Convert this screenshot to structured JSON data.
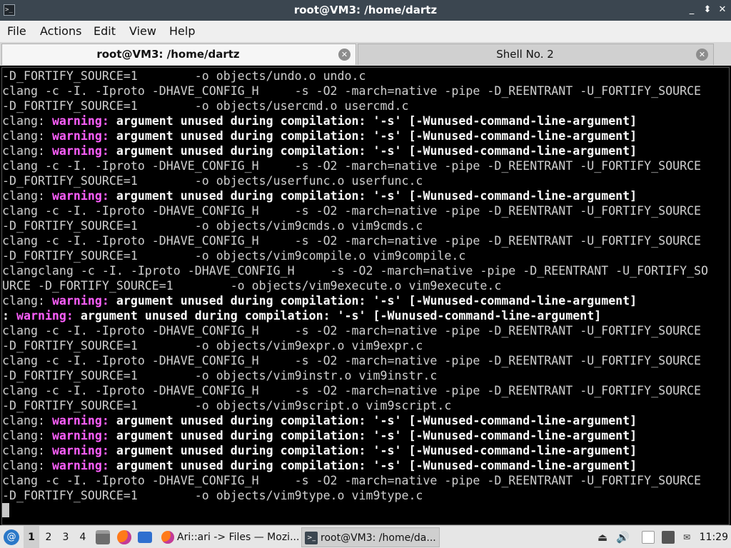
{
  "window": {
    "title": "root@VM3: /home/dartz",
    "controls": {
      "minimize": "_",
      "maximize": "⬍",
      "close": "✕"
    }
  },
  "menu": [
    "File",
    "Actions",
    "Edit",
    "View",
    "Help"
  ],
  "tabs": [
    {
      "label": "root@VM3: /home/dartz",
      "close": "✕"
    },
    {
      "label": "Shell No. 2",
      "close": "✕"
    }
  ],
  "terminal": {
    "lines": [
      [
        {
          "t": "-D_FORTIFY_SOURCE=1        -o objects/undo.o undo.c"
        }
      ],
      [
        {
          "t": "clang -c -I. -Iproto -DHAVE_CONFIG_H     -s -O2 -march=native -pipe -D_REENTRANT -U_FORTIFY_SOURCE"
        }
      ],
      [
        {
          "t": "-D_FORTIFY_SOURCE=1        -o objects/usercmd.o usercmd.c"
        }
      ],
      [
        {
          "t": "clang: "
        },
        {
          "t": "warning:",
          "c": "w"
        },
        {
          "t": " argument unused during compilation: '-s' [-Wunused-command-line-argument]",
          "c": "b"
        }
      ],
      [
        {
          "t": "clang: "
        },
        {
          "t": "warning:",
          "c": "w"
        },
        {
          "t": " argument unused during compilation: '-s' [-Wunused-command-line-argument]",
          "c": "b"
        }
      ],
      [
        {
          "t": "clang: "
        },
        {
          "t": "warning:",
          "c": "w"
        },
        {
          "t": " argument unused during compilation: '-s' [-Wunused-command-line-argument]",
          "c": "b"
        }
      ],
      [
        {
          "t": "clang -c -I. -Iproto -DHAVE_CONFIG_H     -s -O2 -march=native -pipe -D_REENTRANT -U_FORTIFY_SOURCE"
        }
      ],
      [
        {
          "t": "-D_FORTIFY_SOURCE=1        -o objects/userfunc.o userfunc.c"
        }
      ],
      [
        {
          "t": "clang: "
        },
        {
          "t": "warning:",
          "c": "w"
        },
        {
          "t": " argument unused during compilation: '-s' [-Wunused-command-line-argument]",
          "c": "b"
        }
      ],
      [
        {
          "t": "clang -c -I. -Iproto -DHAVE_CONFIG_H     -s -O2 -march=native -pipe -D_REENTRANT -U_FORTIFY_SOURCE"
        }
      ],
      [
        {
          "t": "-D_FORTIFY_SOURCE=1        -o objects/vim9cmds.o vim9cmds.c"
        }
      ],
      [
        {
          "t": "clang -c -I. -Iproto -DHAVE_CONFIG_H     -s -O2 -march=native -pipe -D_REENTRANT -U_FORTIFY_SOURCE"
        }
      ],
      [
        {
          "t": "-D_FORTIFY_SOURCE=1        -o objects/vim9compile.o vim9compile.c"
        }
      ],
      [
        {
          "t": "clangclang -c -I. -Iproto -DHAVE_CONFIG_H     -s -O2 -march=native -pipe -D_REENTRANT -U_FORTIFY_SO"
        }
      ],
      [
        {
          "t": "URCE -D_FORTIFY_SOURCE=1        -o objects/vim9execute.o vim9execute.c"
        }
      ],
      [
        {
          "t": "clang: "
        },
        {
          "t": "warning:",
          "c": "w"
        },
        {
          "t": " argument unused during compilation: '-s' [-Wunused-command-line-argument]",
          "c": "b"
        }
      ],
      [
        {
          "t": ": ",
          "c": "b"
        },
        {
          "t": "warning:",
          "c": "w"
        },
        {
          "t": " argument unused during compilation: '-s' [-Wunused-command-line-argument]",
          "c": "b"
        }
      ],
      [
        {
          "t": "clang -c -I. -Iproto -DHAVE_CONFIG_H     -s -O2 -march=native -pipe -D_REENTRANT -U_FORTIFY_SOURCE"
        }
      ],
      [
        {
          "t": "-D_FORTIFY_SOURCE=1        -o objects/vim9expr.o vim9expr.c"
        }
      ],
      [
        {
          "t": "clang -c -I. -Iproto -DHAVE_CONFIG_H     -s -O2 -march=native -pipe -D_REENTRANT -U_FORTIFY_SOURCE"
        }
      ],
      [
        {
          "t": "-D_FORTIFY_SOURCE=1        -o objects/vim9instr.o vim9instr.c"
        }
      ],
      [
        {
          "t": "clang -c -I. -Iproto -DHAVE_CONFIG_H     -s -O2 -march=native -pipe -D_REENTRANT -U_FORTIFY_SOURCE"
        }
      ],
      [
        {
          "t": "-D_FORTIFY_SOURCE=1        -o objects/vim9script.o vim9script.c"
        }
      ],
      [
        {
          "t": "clang: "
        },
        {
          "t": "warning:",
          "c": "w"
        },
        {
          "t": " argument unused during compilation: '-s' [-Wunused-command-line-argument]",
          "c": "b"
        }
      ],
      [
        {
          "t": "clang: "
        },
        {
          "t": "warning:",
          "c": "w"
        },
        {
          "t": " argument unused during compilation: '-s' [-Wunused-command-line-argument]",
          "c": "b"
        }
      ],
      [
        {
          "t": "clang: "
        },
        {
          "t": "warning:",
          "c": "w"
        },
        {
          "t": " argument unused during compilation: '-s' [-Wunused-command-line-argument]",
          "c": "b"
        }
      ],
      [
        {
          "t": "clang: "
        },
        {
          "t": "warning:",
          "c": "w"
        },
        {
          "t": " argument unused during compilation: '-s' [-Wunused-command-line-argument]",
          "c": "b"
        }
      ],
      [
        {
          "t": "clang -c -I. -Iproto -DHAVE_CONFIG_H     -s -O2 -march=native -pipe -D_REENTRANT -U_FORTIFY_SOURCE"
        }
      ],
      [
        {
          "t": "-D_FORTIFY_SOURCE=1        -o objects/vim9type.o vim9type.c"
        }
      ]
    ],
    "colors": {
      "warning": "#ff5fff",
      "text": "#cfcfcf",
      "bold": "#ffffff",
      "background": "#000000"
    }
  },
  "taskbar": {
    "menu_icon": "debian-swirl-icon",
    "workspaces": [
      "1",
      "2",
      "3",
      "4"
    ],
    "quicklaunch": [
      "file-manager-icon",
      "firefox-icon",
      "desktop-icon"
    ],
    "tasks": [
      {
        "label": "Ari::ari -> Files — Mozi...",
        "icon": "firefox-icon"
      },
      {
        "label": "root@VM3: /home/da...",
        "icon": "terminal-icon"
      }
    ],
    "tray": [
      "eject-icon",
      "volume-icon",
      "clipboard-icon",
      "network-icon"
    ],
    "clock": "11:29"
  }
}
